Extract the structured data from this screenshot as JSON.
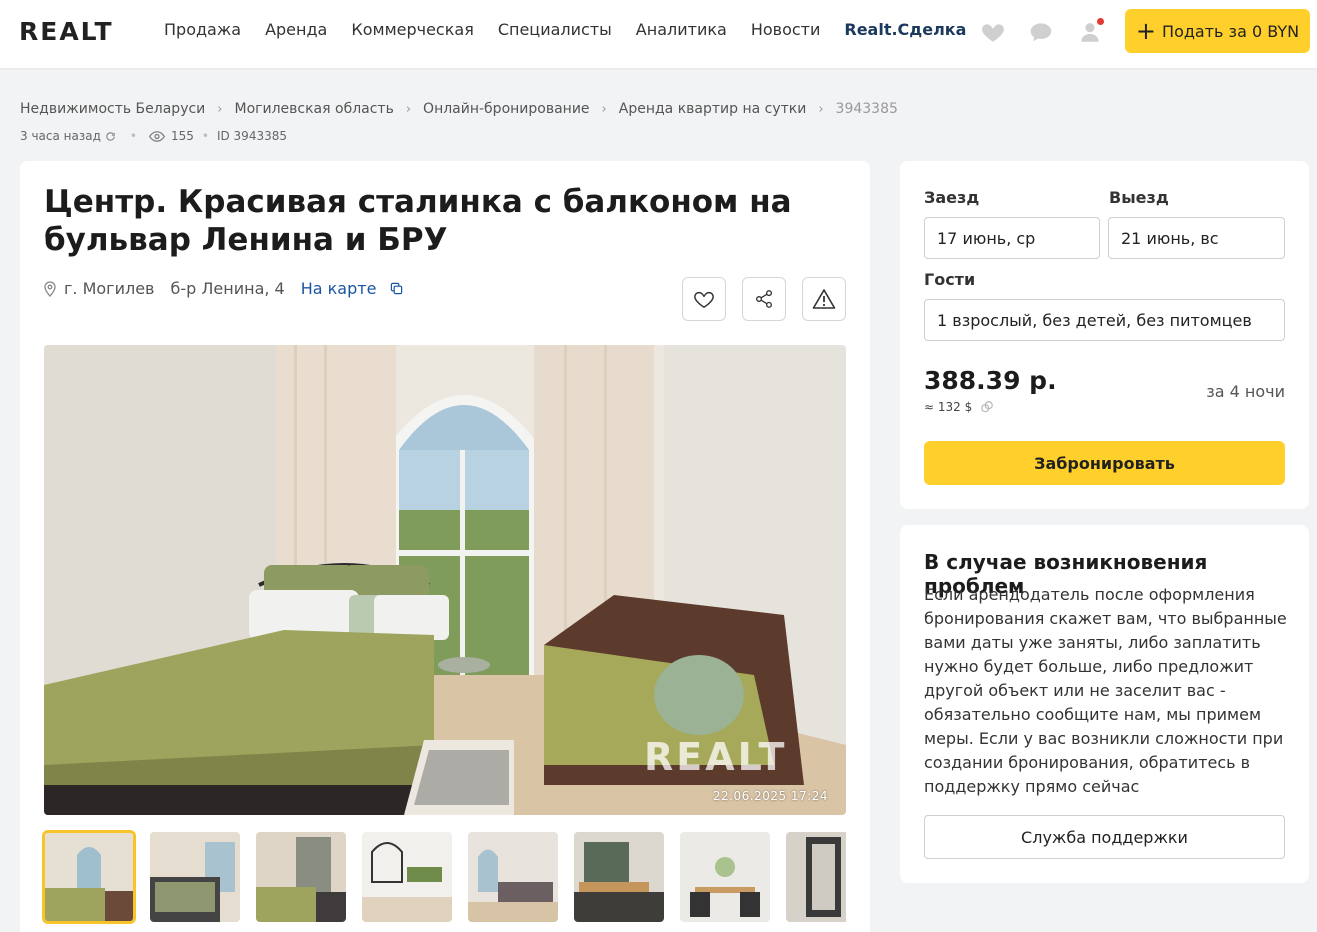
{
  "header": {
    "logo": "REALT",
    "nav": [
      "Продажа",
      "Аренда",
      "Коммерческая",
      "Специалисты",
      "Аналитика",
      "Новости",
      "Realt.Сделка"
    ],
    "post_button": "Подать за 0 BYN",
    "icons": [
      "heart-icon",
      "chat-icon",
      "user-icon"
    ]
  },
  "breadcrumb": {
    "items": [
      "Недвижимость Беларуси",
      "Могилевская область",
      "Онлайн-бронирование",
      "Аренда квартир на сутки",
      "3943385"
    ]
  },
  "meta": {
    "time": "3 часа назад",
    "views": "155",
    "id": "ID 3943385"
  },
  "listing": {
    "title": "Центр. Красивая сталинка с балконом на бульвар Ленина и БРУ",
    "city": "г. Могилев",
    "street": "б-р Ленина, 4",
    "map_link": "На карте",
    "photo_date": "22.06.2025  17:24",
    "watermark": "REALT",
    "thumbnail_count": 8
  },
  "booking": {
    "checkin_label": "Заезд",
    "checkout_label": "Выезд",
    "checkin_value": "17 июнь, ср",
    "checkout_value": "21 июнь, вс",
    "guests_label": "Гости",
    "guests_value": "1 взрослый, без детей, без питомцев",
    "price": "388.39 р.",
    "price_usd": "≈ 132 $",
    "nights": "за 4 ночи",
    "book_button": "Забронировать"
  },
  "problems": {
    "title": "В случае возникновения проблем",
    "text": "Если арендодатель после оформления бронирования скажет вам, что выбранные вами даты уже заняты, либо заплатить нужно будет больше, либо предложит другой объект или не заселит вас - обязательно сообщите нам, мы примем меры. Если у вас возникли сложности при создании бронирования, обратитесь в поддержку прямо сейчас",
    "support_button": "Служба поддержки"
  },
  "colors": {
    "accent": "#ffd02b",
    "link": "#1a55a3",
    "background": "#f2f3f5"
  }
}
